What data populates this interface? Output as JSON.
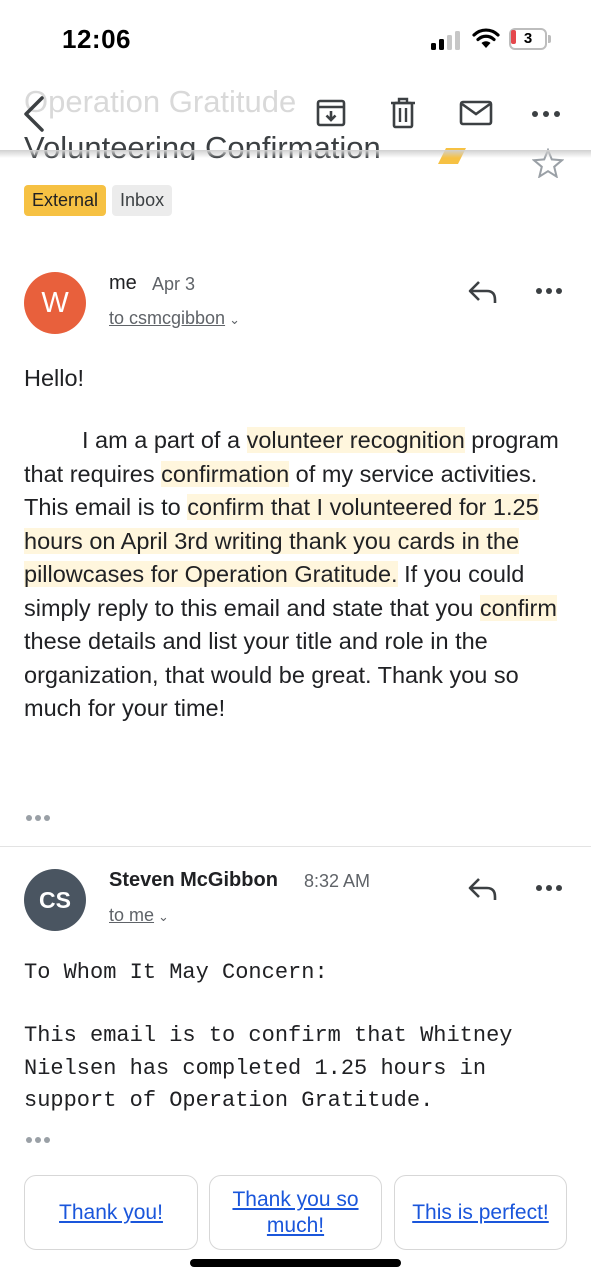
{
  "status_bar": {
    "time": "12:06",
    "battery_level": "3",
    "battery_color": "#e5484d"
  },
  "toolbar": {
    "subject_ghost": "Operation Gratitude",
    "subject": "Volunteering Confirmation"
  },
  "labels": [
    {
      "label": "External",
      "color": "#f6c143"
    },
    {
      "label": "Inbox",
      "color": "#ececec"
    }
  ],
  "messages": [
    {
      "avatar": "W",
      "avatar_color": "#e8603c",
      "sender": "me",
      "date": "Apr 3",
      "recipient": "to csmcgibbon",
      "greeting": "Hello!",
      "body": {
        "p1": "I am a part of a ",
        "h1": "volunteer recognition",
        "p2": " program that requires ",
        "h2": "confirmation",
        "p3": " of my service activities. This email is to ",
        "h3": "confirm that I volunteered for 1.25 hours on April 3rd writing thank you cards in the pillowcases for Operation Gratitude.",
        "p4": " If you could simply reply to this email and state that you ",
        "h4": "confirm",
        "p5": " these details and list your title and role in the organization, that would be great. Thank you so much for your time!"
      }
    },
    {
      "avatar": "CS",
      "avatar_color": "#4a5561",
      "sender": "Steven McGibbon",
      "date": "8:32 AM",
      "recipient": "to me",
      "greeting": "To Whom It May Concern:",
      "body": "This email is to confirm that Whitney Nielsen has completed 1.25 hours in support of Operation Gratitude."
    }
  ],
  "smart_replies": [
    "Thank you!",
    "Thank you so much!",
    "This is perfect!"
  ],
  "colors": {
    "link": "#1a56db",
    "highlight": "#fff6dd",
    "accent_label": "#f6c143"
  }
}
